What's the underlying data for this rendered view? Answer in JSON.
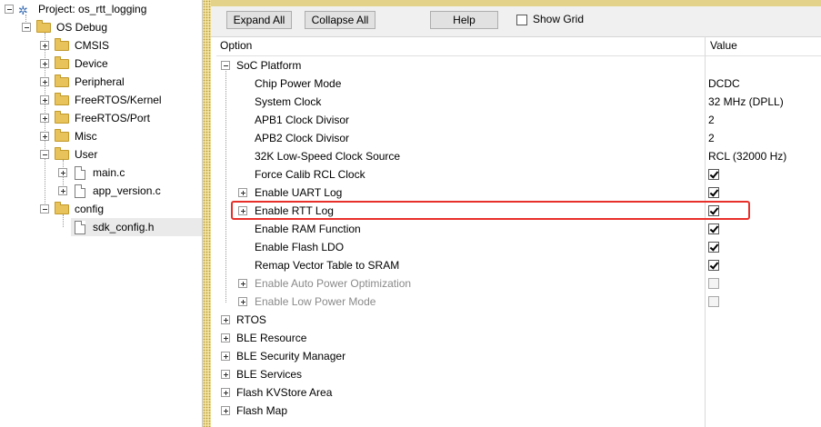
{
  "tree": {
    "project_label": "Project: os_rtt_logging",
    "target_label": "OS Debug",
    "groups": [
      "CMSIS",
      "Device",
      "Peripheral",
      "FreeRTOS/Kernel",
      "FreeRTOS/Port",
      "Misc",
      "User"
    ],
    "user_files": [
      "main.c",
      "app_version.c"
    ],
    "config_label": "config",
    "config_files": [
      "sdk_config.h"
    ]
  },
  "toolbar": {
    "expand_all": "Expand All",
    "collapse_all": "Collapse All",
    "help": "Help",
    "show_grid": "Show Grid",
    "show_grid_checked": false
  },
  "grid": {
    "option_header": "Option",
    "value_header": "Value",
    "soc_platform": "SoC Platform",
    "soc_items": [
      {
        "label": "Chip Power Mode",
        "value": "DCDC"
      },
      {
        "label": "System Clock",
        "value": "32 MHz (DPLL)"
      },
      {
        "label": "APB1 Clock Divisor",
        "value": "2"
      },
      {
        "label": "APB2 Clock Divisor",
        "value": "2"
      },
      {
        "label": "32K Low-Speed Clock Source",
        "value": "RCL (32000 Hz)"
      },
      {
        "label": "Force Calib RCL Clock",
        "checked": true
      },
      {
        "label": "Enable UART Log",
        "checked": true,
        "expandable": true
      },
      {
        "label": "Enable RTT Log",
        "checked": true,
        "expandable": true,
        "highlighted": true
      },
      {
        "label": "Enable RAM Function",
        "checked": true
      },
      {
        "label": "Enable Flash LDO",
        "checked": true
      },
      {
        "label": "Remap Vector Table to SRAM",
        "checked": true
      },
      {
        "label": "Enable Auto Power Optimization",
        "checked": false,
        "expandable": true,
        "disabled": true
      },
      {
        "label": "Enable Low Power Mode",
        "checked": false,
        "expandable": true,
        "disabled": true
      }
    ],
    "groups": [
      "RTOS",
      "BLE Resource",
      "BLE Security Manager",
      "BLE Services",
      "Flash KVStore Area",
      "Flash Map"
    ]
  },
  "colors": {
    "highlight_border": "#e8302a",
    "folder": "#e8c25a",
    "splitter": "#f3e3a0"
  }
}
